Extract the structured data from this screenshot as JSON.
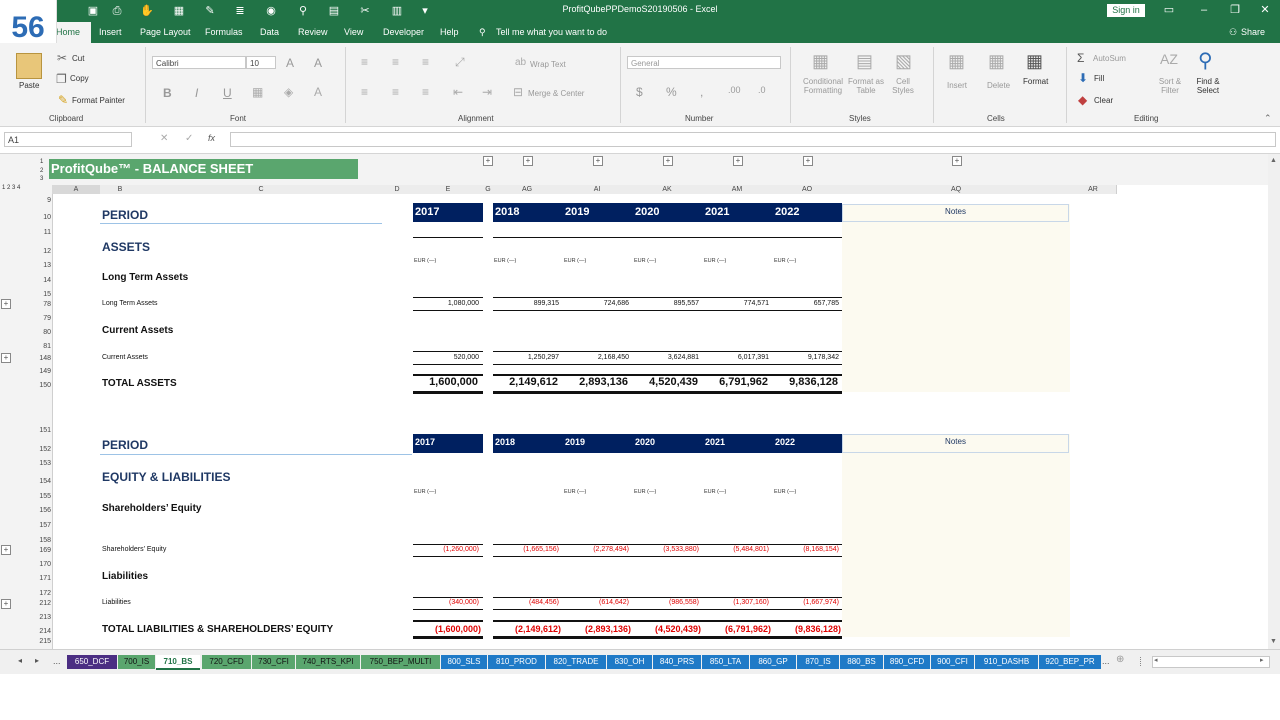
{
  "window": {
    "title": "ProfitQubePPDemoS20190506  -  Excel",
    "signin": "Sign in",
    "logo_number": "56"
  },
  "ribbon_tabs": [
    "Home",
    "Insert",
    "Page Layout",
    "Formulas",
    "Data",
    "Review",
    "View",
    "Developer",
    "Help"
  ],
  "tell_me": "Tell me what you want to do",
  "share": "Share",
  "clipboard": {
    "paste": "Paste",
    "cut": "Cut",
    "copy": "Copy",
    "format_painter": "Format Painter",
    "label": "Clipboard"
  },
  "font": {
    "name": "Calibri",
    "size": "10",
    "label": "Font",
    "bold": "B",
    "italic": "I",
    "underline": "U"
  },
  "alignment": {
    "wrap": "Wrap Text",
    "merge": "Merge & Center",
    "label": "Alignment"
  },
  "number": {
    "format": "General",
    "label": "Number",
    "currency": "$",
    "percent": "%",
    "comma": ","
  },
  "styles": {
    "conditional": "Conditional Formatting",
    "format_table": "Format as Table",
    "cell_styles": "Cell Styles",
    "label": "Styles"
  },
  "cells": {
    "insert": "Insert",
    "delete": "Delete",
    "format": "Format",
    "label": "Cells"
  },
  "editing": {
    "autosum": "AutoSum",
    "fill": "Fill",
    "clear": "Clear",
    "sort": "Sort & Filter",
    "find": "Find & Select",
    "label": "Editing"
  },
  "formula_bar": {
    "name_box": "A1",
    "fx": "fx",
    "content": ""
  },
  "columns": [
    "A",
    "B",
    "C",
    "D",
    "E",
    "G",
    "AG",
    "AI",
    "AK",
    "AM",
    "AO",
    "AQ",
    "AR"
  ],
  "rows": [
    "9",
    "10",
    "11",
    "12",
    "13",
    "14",
    "15",
    "78",
    "79",
    "80",
    "81",
    "148",
    "149",
    "150",
    "151",
    "152",
    "153",
    "154",
    "155",
    "156",
    "157",
    "158",
    "169",
    "170",
    "171",
    "172",
    "212",
    "213",
    "214",
    "215"
  ],
  "outline_levels": [
    "1",
    "2",
    "3",
    "4"
  ],
  "sheet": {
    "title": "ProfitQube™ - BALANCE SHEET",
    "period": "PERIOD",
    "years": [
      "2017",
      "2018",
      "2019",
      "2020",
      "2021",
      "2022"
    ],
    "notes": "Notes",
    "unit": "EUR (—)",
    "assets": "ASSETS",
    "long_term_header": "Long Term Assets",
    "long_term_label": "Long Term Assets",
    "long_term_values": [
      "1,080,000",
      "899,315",
      "724,686",
      "895,557",
      "774,571",
      "657,785"
    ],
    "current_header": "Current Assets",
    "current_label": "Current Assets",
    "current_values": [
      "520,000",
      "1,250,297",
      "2,168,450",
      "3,624,881",
      "6,017,391",
      "9,178,342"
    ],
    "total_assets_label": "TOTAL ASSETS",
    "total_assets_values": [
      "1,600,000",
      "2,149,612",
      "2,893,136",
      "4,520,439",
      "6,791,962",
      "9,836,128"
    ],
    "eq_liab": "EQUITY & LIABILITIES",
    "sh_header": "Shareholders’ Equity",
    "sh_label": "Shareholders’ Equity",
    "sh_values": [
      "(1,260,000)",
      "(1,665,156)",
      "(2,278,494)",
      "(3,533,880)",
      "(5,484,801)",
      "(8,168,154)"
    ],
    "liab_header": "Liabilities",
    "liab_label": "Liabilities",
    "liab_values": [
      "(340,000)",
      "(484,456)",
      "(614,642)",
      "(986,558)",
      "(1,307,160)",
      "(1,667,974)"
    ],
    "total_le_label": "TOTAL LIABILITIES & SHAREHOLDERS’ EQUITY",
    "total_le_values": [
      "(1,600,000)",
      "(2,149,612)",
      "(2,893,136)",
      "(4,520,439)",
      "(6,791,962)",
      "(9,836,128)"
    ]
  },
  "sheet_tabs": [
    {
      "name": "650_DCF",
      "color": "#4b2e83"
    },
    {
      "name": "700_IS",
      "color": "#5aa66e"
    },
    {
      "name": "710_BS",
      "color": "#ffffff"
    },
    {
      "name": "720_CFD",
      "color": "#5aa66e"
    },
    {
      "name": "730_CFI",
      "color": "#5aa66e"
    },
    {
      "name": "740_RTS_KPI",
      "color": "#5aa66e"
    },
    {
      "name": "750_BEP_MULTI",
      "color": "#5aa66e"
    },
    {
      "name": "800_SLS",
      "color": "#1f7ac7"
    },
    {
      "name": "810_PROD",
      "color": "#1f7ac7"
    },
    {
      "name": "820_TRADE",
      "color": "#1f7ac7"
    },
    {
      "name": "830_OH",
      "color": "#1f7ac7"
    },
    {
      "name": "840_PRS",
      "color": "#1f7ac7"
    },
    {
      "name": "850_LTA",
      "color": "#1f7ac7"
    },
    {
      "name": "860_GP",
      "color": "#1f7ac7"
    },
    {
      "name": "870_IS",
      "color": "#1f7ac7"
    },
    {
      "name": "880_BS",
      "color": "#1f7ac7"
    },
    {
      "name": "890_CFD",
      "color": "#1f7ac7"
    },
    {
      "name": "900_CFI",
      "color": "#1f7ac7"
    },
    {
      "name": "910_DASHB",
      "color": "#1f7ac7"
    },
    {
      "name": "920_BEP_PR",
      "color": "#1f7ac7"
    }
  ],
  "tab_nav_more": "..."
}
